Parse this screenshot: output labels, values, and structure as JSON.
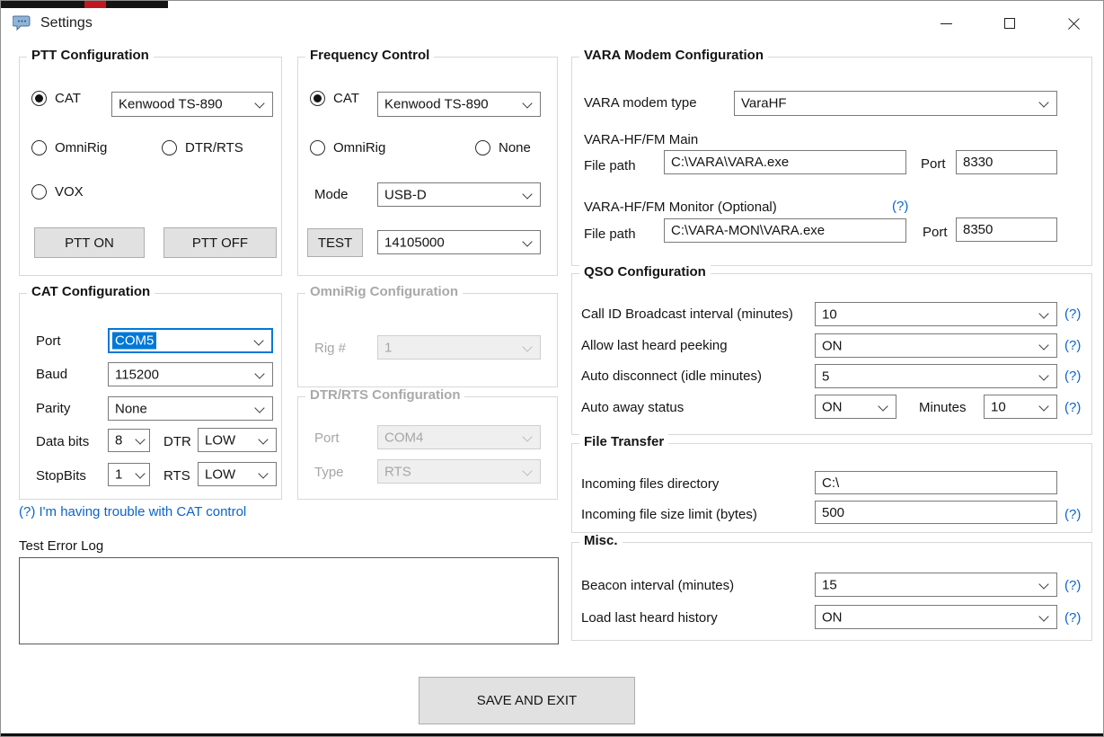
{
  "window": {
    "title": "Settings"
  },
  "help_glyph": "(?)",
  "colors": {
    "accent": "#0078d7",
    "link": "#0a64cc"
  },
  "ptt": {
    "title": "PTT Configuration",
    "cat_label": "CAT",
    "omnirig_label": "OmniRig",
    "dtrrts_label": "DTR/RTS",
    "vox_label": "VOX",
    "device": "Kenwood TS-890",
    "ptt_on": "PTT ON",
    "ptt_off": "PTT OFF"
  },
  "freq": {
    "title": "Frequency Control",
    "cat_label": "CAT",
    "omnirig_label": "OmniRig",
    "none_label": "None",
    "device": "Kenwood TS-890",
    "mode_label": "Mode",
    "mode_value": "USB-D",
    "test_button": "TEST",
    "frequency": "14105000"
  },
  "cat_config": {
    "title": "CAT Configuration",
    "port_label": "Port",
    "port_value": "COM5",
    "baud_label": "Baud",
    "baud_value": "115200",
    "parity_label": "Parity",
    "parity_value": "None",
    "databits_label": "Data bits",
    "databits_value": "8",
    "dtr_label": "DTR",
    "dtr_value": "LOW",
    "stopbits_label": "StopBits",
    "stopbits_value": "1",
    "rts_label": "RTS",
    "rts_value": "LOW"
  },
  "omnirig_config": {
    "title": "OmniRig Configuration",
    "rig_label": "Rig #",
    "rig_value": "1"
  },
  "dtr_config": {
    "title": "DTR/RTS Configuration",
    "port_label": "Port",
    "port_value": "COM4",
    "type_label": "Type",
    "type_value": "RTS"
  },
  "cat_help_link": "(?) I'm having trouble with CAT control",
  "log": {
    "label": "Test Error Log",
    "value": ""
  },
  "vara": {
    "title": "VARA Modem Configuration",
    "type_label": "VARA modem type",
    "type_value": "VaraHF",
    "main_header": "VARA-HF/FM Main",
    "file_path_label": "File path",
    "main_path": "C:\\VARA\\VARA.exe",
    "port_label": "Port",
    "main_port": "8330",
    "monitor_header": "VARA-HF/FM Monitor (Optional)",
    "monitor_path": "C:\\VARA-MON\\VARA.exe",
    "monitor_port": "8350"
  },
  "qso": {
    "title": "QSO Configuration",
    "rows": [
      {
        "label": "Call ID Broadcast interval (minutes)",
        "value": "10"
      },
      {
        "label": "Allow last heard peeking",
        "value": "ON"
      },
      {
        "label": "Auto disconnect (idle minutes)",
        "value": "5"
      }
    ],
    "away_label": "Auto away status",
    "away_value": "ON",
    "minutes_label": "Minutes",
    "minutes_value": "10"
  },
  "file_transfer": {
    "title": "File Transfer",
    "dir_label": "Incoming files directory",
    "dir_value": "C:\\",
    "limit_label": "Incoming file size limit (bytes)",
    "limit_value": "500"
  },
  "misc": {
    "title": "Misc.",
    "beacon_label": "Beacon interval (minutes)",
    "beacon_value": "15",
    "history_label": "Load last heard history",
    "history_value": "ON"
  },
  "save_button": "SAVE AND EXIT"
}
